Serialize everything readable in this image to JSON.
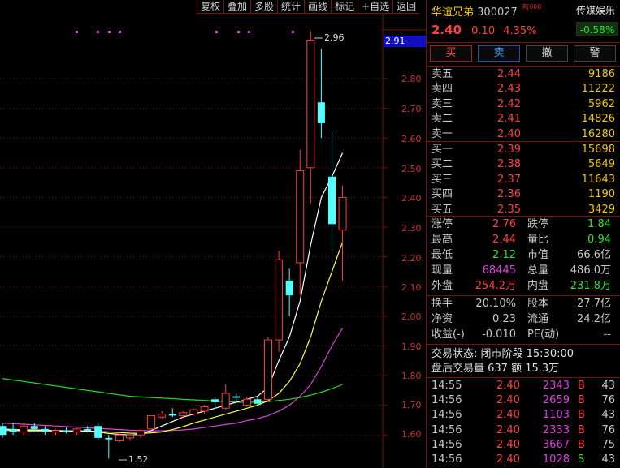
{
  "toolbar": [
    "复权",
    "叠加",
    "多股",
    "统计",
    "画线",
    "标记",
    "+自选",
    "返回"
  ],
  "chart": {
    "y_ticks": [
      "2.80",
      "2.70",
      "2.60",
      "2.50",
      "2.40",
      "2.30",
      "2.20",
      "2.10",
      "2.00",
      "1.90",
      "1.80",
      "1.70",
      "1.60"
    ],
    "price_tag": "2.91",
    "high_label": "2.96",
    "low_label": "1.52",
    "colors": {
      "up": "#ff3c3c",
      "down": "#54ffff",
      "ma5": "#ffffff",
      "ma10": "#ffff40",
      "ma20": "#e040e0",
      "ma60": "#20e020",
      "grid": "#7a1010"
    }
  },
  "chart_data": {
    "type": "candlestick",
    "ylim": [
      1.52,
      2.96
    ],
    "candles": [
      {
        "o": 1.63,
        "h": 1.64,
        "l": 1.59,
        "c": 1.6
      },
      {
        "o": 1.62,
        "h": 1.64,
        "l": 1.6,
        "c": 1.61
      },
      {
        "o": 1.61,
        "h": 1.64,
        "l": 1.6,
        "c": 1.63
      },
      {
        "o": 1.63,
        "h": 1.64,
        "l": 1.61,
        "c": 1.62
      },
      {
        "o": 1.62,
        "h": 1.63,
        "l": 1.6,
        "c": 1.61
      },
      {
        "o": 1.61,
        "h": 1.62,
        "l": 1.6,
        "c": 1.615
      },
      {
        "o": 1.615,
        "h": 1.625,
        "l": 1.605,
        "c": 1.61
      },
      {
        "o": 1.61,
        "h": 1.625,
        "l": 1.6,
        "c": 1.62
      },
      {
        "o": 1.62,
        "h": 1.63,
        "l": 1.61,
        "c": 1.615
      },
      {
        "o": 1.63,
        "h": 1.64,
        "l": 1.58,
        "c": 1.59
      },
      {
        "o": 1.59,
        "h": 1.6,
        "l": 1.52,
        "c": 1.585
      },
      {
        "o": 1.58,
        "h": 1.61,
        "l": 1.575,
        "c": 1.6
      },
      {
        "o": 1.59,
        "h": 1.61,
        "l": 1.58,
        "c": 1.6
      },
      {
        "o": 1.6,
        "h": 1.62,
        "l": 1.59,
        "c": 1.615
      },
      {
        "o": 1.62,
        "h": 1.66,
        "l": 1.615,
        "c": 1.665
      },
      {
        "o": 1.66,
        "h": 1.68,
        "l": 1.655,
        "c": 1.67
      },
      {
        "o": 1.67,
        "h": 1.69,
        "l": 1.66,
        "c": 1.665
      },
      {
        "o": 1.665,
        "h": 1.68,
        "l": 1.66,
        "c": 1.675
      },
      {
        "o": 1.67,
        "h": 1.69,
        "l": 1.665,
        "c": 1.685
      },
      {
        "o": 1.68,
        "h": 1.7,
        "l": 1.67,
        "c": 1.695
      },
      {
        "o": 1.72,
        "h": 1.73,
        "l": 1.69,
        "c": 1.71
      },
      {
        "o": 1.69,
        "h": 1.77,
        "l": 1.685,
        "c": 1.74
      },
      {
        "o": 1.73,
        "h": 1.74,
        "l": 1.71,
        "c": 1.725
      },
      {
        "o": 1.7,
        "h": 1.73,
        "l": 1.695,
        "c": 1.72
      },
      {
        "o": 1.72,
        "h": 1.73,
        "l": 1.7,
        "c": 1.705
      },
      {
        "o": 1.72,
        "h": 1.93,
        "l": 1.71,
        "c": 1.92
      },
      {
        "o": 1.92,
        "h": 2.22,
        "l": 1.88,
        "c": 2.19
      },
      {
        "o": 2.12,
        "h": 2.16,
        "l": 2.0,
        "c": 2.07
      },
      {
        "o": 2.18,
        "h": 2.56,
        "l": 2.07,
        "c": 2.49
      },
      {
        "o": 2.5,
        "h": 2.96,
        "l": 2.38,
        "c": 2.93
      },
      {
        "o": 2.72,
        "h": 2.9,
        "l": 2.6,
        "c": 2.65
      },
      {
        "o": 2.47,
        "h": 2.62,
        "l": 2.22,
        "c": 2.31
      },
      {
        "o": 2.29,
        "h": 2.44,
        "l": 2.12,
        "c": 2.4
      }
    ],
    "ma5": [
      1.62,
      1.618,
      1.617,
      1.617,
      1.616,
      1.615,
      1.614,
      1.613,
      1.613,
      1.61,
      1.605,
      1.602,
      1.6,
      1.602,
      1.615,
      1.63,
      1.645,
      1.66,
      1.67,
      1.68,
      1.69,
      1.7,
      1.71,
      1.72,
      1.73,
      1.76,
      1.85,
      1.93,
      2.05,
      2.24,
      2.4,
      2.47,
      2.55
    ],
    "ma10": [
      1.615,
      1.615,
      1.614,
      1.614,
      1.614,
      1.613,
      1.613,
      1.613,
      1.613,
      1.612,
      1.61,
      1.608,
      1.606,
      1.605,
      1.607,
      1.61,
      1.618,
      1.628,
      1.64,
      1.65,
      1.66,
      1.67,
      1.68,
      1.69,
      1.7,
      1.715,
      1.74,
      1.78,
      1.84,
      1.93,
      2.05,
      2.15,
      2.25
    ],
    "ma20": [
      1.64,
      1.638,
      1.636,
      1.634,
      1.632,
      1.63,
      1.628,
      1.626,
      1.624,
      1.622,
      1.62,
      1.618,
      1.616,
      1.615,
      1.614,
      1.614,
      1.615,
      1.617,
      1.62,
      1.625,
      1.63,
      1.635,
      1.64,
      1.648,
      1.655,
      1.665,
      1.68,
      1.7,
      1.73,
      1.77,
      1.83,
      1.9,
      1.96
    ],
    "ma60": [
      1.79,
      1.785,
      1.78,
      1.775,
      1.77,
      1.765,
      1.76,
      1.755,
      1.75,
      1.745,
      1.74,
      1.735,
      1.73,
      1.728,
      1.726,
      1.724,
      1.722,
      1.72,
      1.718,
      1.716,
      1.714,
      1.712,
      1.71,
      1.71,
      1.71,
      1.712,
      1.716,
      1.72,
      1.726,
      1.734,
      1.744,
      1.756,
      1.77
    ]
  },
  "stock": {
    "name": "华谊兄弟",
    "code": "300027",
    "flag": "R|000",
    "sector": "传媒娱乐",
    "sector_change": "-0.58%",
    "price": "2.40",
    "change": "0.10",
    "change_pct": "4.35%"
  },
  "actions": {
    "buy": "买",
    "sell": "卖",
    "cancel": "撤",
    "alert": "警"
  },
  "asks": [
    {
      "label": "卖五",
      "price": "2.44",
      "vol": "9186"
    },
    {
      "label": "卖四",
      "price": "2.43",
      "vol": "11222"
    },
    {
      "label": "卖三",
      "price": "2.42",
      "vol": "5962"
    },
    {
      "label": "卖二",
      "price": "2.41",
      "vol": "14826"
    },
    {
      "label": "卖一",
      "price": "2.40",
      "vol": "16280"
    }
  ],
  "bids": [
    {
      "label": "买一",
      "price": "2.39",
      "vol": "15698"
    },
    {
      "label": "买二",
      "price": "2.38",
      "vol": "5649"
    },
    {
      "label": "买三",
      "price": "2.37",
      "vol": "11643"
    },
    {
      "label": "买四",
      "price": "2.36",
      "vol": "1190"
    },
    {
      "label": "买五",
      "price": "2.35",
      "vol": "3429"
    }
  ],
  "stats": [
    {
      "l1": "涨停",
      "v1": "2.76",
      "c1": "red",
      "l2": "跌停",
      "v2": "1.84",
      "c2": "green"
    },
    {
      "l1": "最高",
      "v1": "2.44",
      "c1": "red",
      "l2": "量比",
      "v2": "0.94",
      "c2": "green"
    },
    {
      "l1": "最低",
      "v1": "2.12",
      "c1": "green",
      "l2": "市值",
      "v2": "66.6亿",
      "c2": "gray"
    },
    {
      "l1": "现量",
      "v1": "68445",
      "c1": "magenta",
      "l2": "总量",
      "v2": "486.0万",
      "c2": "gray"
    },
    {
      "l1": "外盘",
      "v1": "254.2万",
      "c1": "red",
      "l2": "内盘",
      "v2": "231.8万",
      "c2": "green"
    }
  ],
  "stats2": [
    {
      "l1": "换手",
      "v1": "20.10%",
      "c1": "gray",
      "l2": "股本",
      "v2": "27.7亿",
      "c2": "gray"
    },
    {
      "l1": "净资",
      "v1": "0.23",
      "c1": "gray",
      "l2": "流通",
      "v2": "24.2亿",
      "c2": "gray"
    },
    {
      "l1": "收益(-)",
      "v1": "-0.010",
      "c1": "gray",
      "l2": "PE(动)",
      "v2": "--",
      "c2": "gray"
    }
  ],
  "status": {
    "trade_state": "交易状态: 闭市阶段 15:30:00",
    "after_hours": "盘后交易量 637 额 15.3万"
  },
  "ticks": [
    {
      "time": "14:55",
      "price": "2.40",
      "vol": "2343",
      "side": "B",
      "n": "43"
    },
    {
      "time": "14:56",
      "price": "2.40",
      "vol": "2659",
      "side": "B",
      "n": "76"
    },
    {
      "time": "14:56",
      "price": "2.40",
      "vol": "1103",
      "side": "B",
      "n": "43"
    },
    {
      "time": "14:56",
      "price": "2.40",
      "vol": "2333",
      "side": "B",
      "n": "76"
    },
    {
      "time": "14:56",
      "price": "2.40",
      "vol": "3667",
      "side": "B",
      "n": "75"
    },
    {
      "time": "14:56",
      "price": "2.40",
      "vol": "1028",
      "side": "S",
      "n": "43"
    }
  ]
}
